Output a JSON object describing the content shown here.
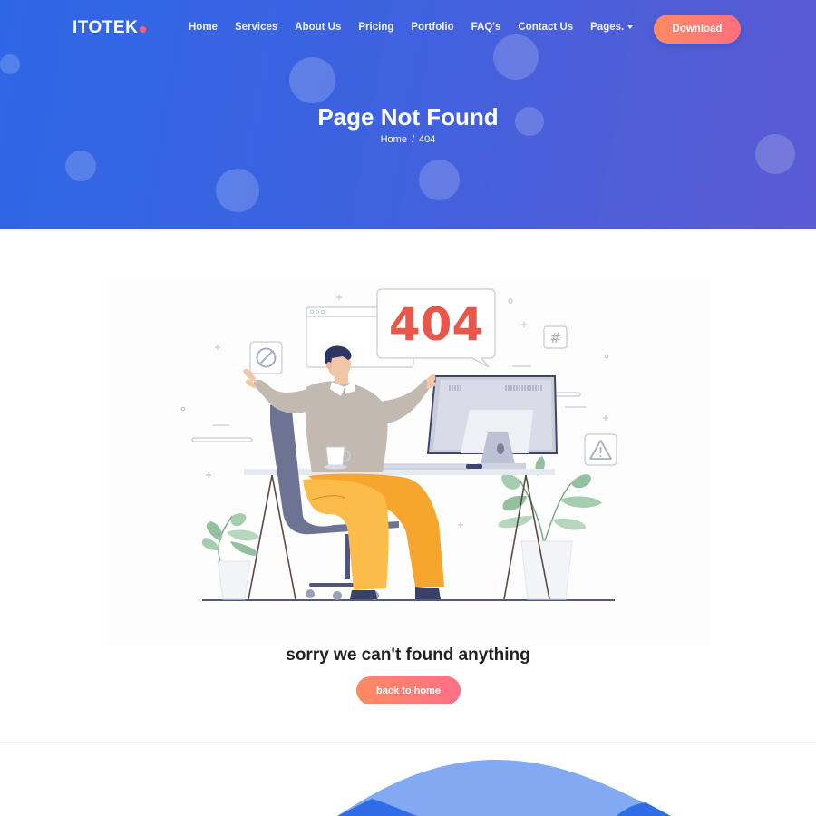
{
  "brand": {
    "name": "ITOTEK",
    "dot_color": "#ff5e73"
  },
  "nav": {
    "items": [
      {
        "label": "Home"
      },
      {
        "label": "Services"
      },
      {
        "label": "About Us"
      },
      {
        "label": "Pricing"
      },
      {
        "label": "Portfolio"
      },
      {
        "label": "FAQ's"
      },
      {
        "label": "Contact Us"
      },
      {
        "label": "Pages."
      }
    ],
    "download_label": "Download"
  },
  "hero": {
    "title": "Page Not Found",
    "breadcrumb": {
      "home": "Home",
      "separator": "/",
      "current": "404"
    }
  },
  "illustration": {
    "error_code": "404",
    "icons": [
      "ban-icon",
      "hash-icon",
      "warning-icon",
      "browser-window-icon",
      "coffee-cup-icon",
      "plant-icon"
    ]
  },
  "main": {
    "message": "sorry we can't found anything",
    "back_label": "back to home"
  },
  "colors": {
    "hero_start": "#2e67e6",
    "hero_end": "#5a5bd3",
    "button_start": "#ff8a63",
    "button_end": "#ff6f7f",
    "error_code": "#e8574a"
  }
}
